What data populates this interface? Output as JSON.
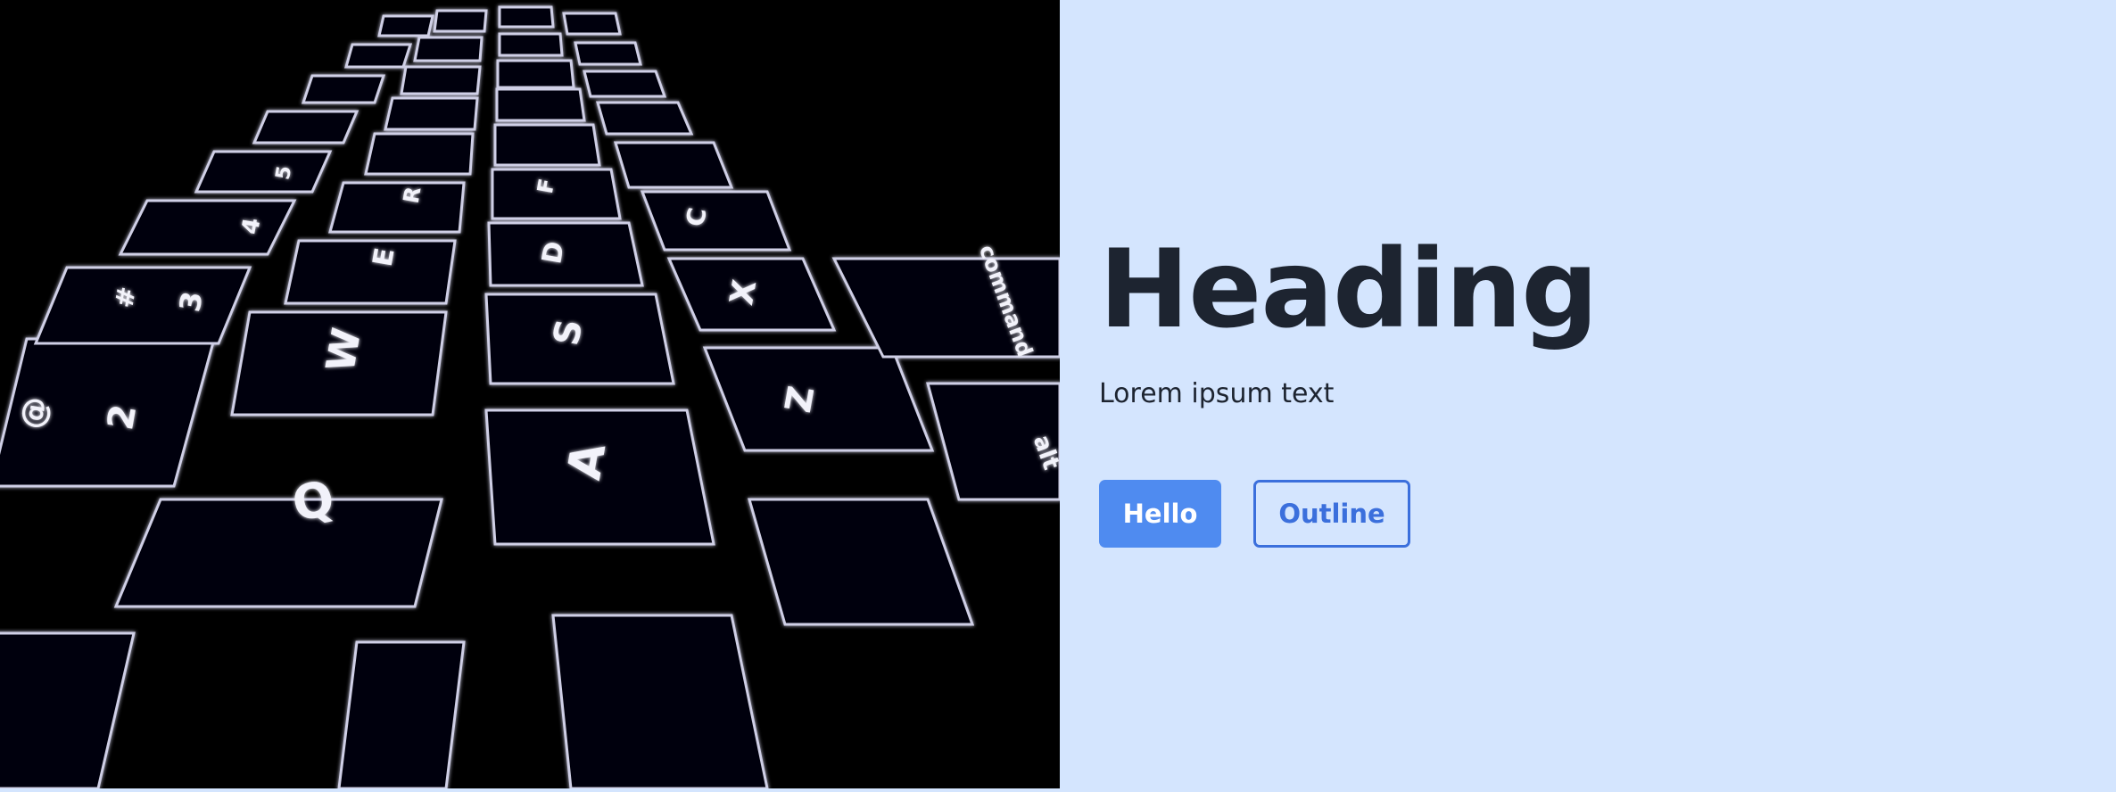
{
  "hero": {
    "image_icon": "backlit-keyboard-photo",
    "visible_keys": [
      "Q",
      "A",
      "W",
      "S",
      "Z",
      "X",
      "E",
      "D",
      "C",
      "R",
      "F",
      "2",
      "@",
      "3",
      "#",
      "4",
      "$",
      "5",
      "%",
      "command",
      "alt"
    ]
  },
  "content": {
    "heading": "Heading",
    "subtext": "Lorem ipsum text"
  },
  "actions": {
    "primary_label": "Hello",
    "outline_label": "Outline"
  },
  "colors": {
    "background": "#d4e5fe",
    "text": "#1d2430",
    "primary": "#4f8bf0",
    "outline": "#3b6fdc",
    "photo_bg": "#000000"
  }
}
